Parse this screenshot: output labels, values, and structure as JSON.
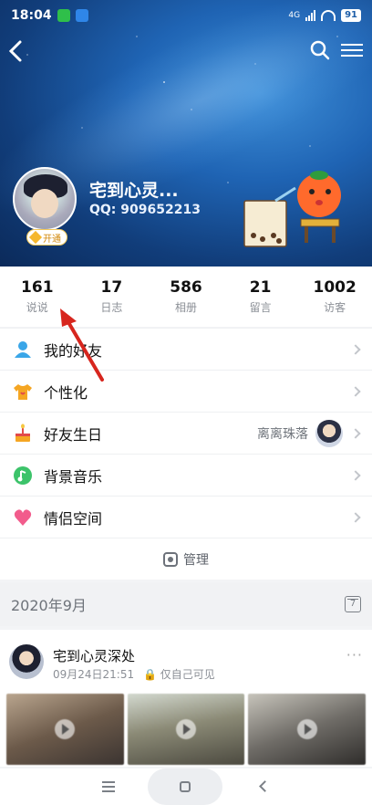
{
  "status_bar": {
    "time": "18:04",
    "battery": "91",
    "network": "4G"
  },
  "nav": {
    "back_icon": "back-arrow-icon",
    "search_icon": "search-icon",
    "menu_icon": "menu-icon"
  },
  "profile": {
    "nickname": "宅到心灵...",
    "qq_number": "QQ: 909652213",
    "vip_badge": "开通"
  },
  "stats": [
    {
      "value": "161",
      "label": "说说"
    },
    {
      "value": "17",
      "label": "日志"
    },
    {
      "value": "586",
      "label": "相册"
    },
    {
      "value": "21",
      "label": "留言"
    },
    {
      "value": "1002",
      "label": "访客"
    }
  ],
  "menu": {
    "items": [
      {
        "label": "我的好友",
        "icon": "friends-icon"
      },
      {
        "label": "个性化",
        "icon": "shirt-icon"
      },
      {
        "label": "好友生日",
        "icon": "cake-icon",
        "extra": "离离珠落"
      },
      {
        "label": "背景音乐",
        "icon": "music-icon"
      },
      {
        "label": "情侣空间",
        "icon": "heart-icon"
      }
    ],
    "manage_label": "管理"
  },
  "feed": {
    "date": "2020年9月",
    "calendar_day": "7",
    "post": {
      "author": "宅到心灵深处",
      "time": "09月24日21:51",
      "privacy": "仅自己可见"
    }
  },
  "colors": {
    "accent_blue": "#1f64b4",
    "annotation_red": "#d7261e"
  }
}
